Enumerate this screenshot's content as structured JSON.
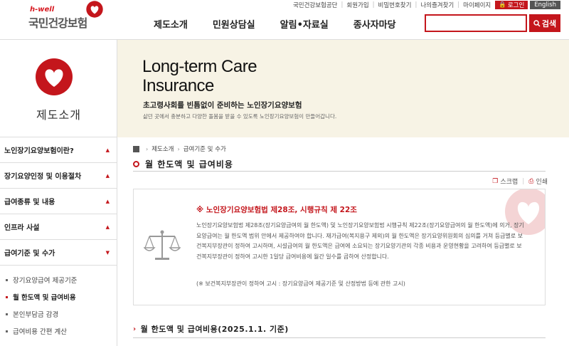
{
  "header": {
    "logo_small": "h-well",
    "logo_main": "국민건강보험",
    "util_links": [
      "국민건강보험공단",
      "회원가입",
      "비밀번호찾기",
      "나의즐겨찾기",
      "마이페이지"
    ],
    "login_label": "로그인",
    "english_label": "English",
    "gnb": [
      "제도소개",
      "민원상담실",
      "알림•자료실",
      "종사자마당"
    ],
    "search_placeholder": "",
    "search_label": "검색",
    "brand_color": "#c4161c"
  },
  "sidebar": {
    "title": "제도소개",
    "menu": [
      {
        "label": "노인장기요양보험이란?"
      },
      {
        "label": "장기요양인정 및 이용절차"
      },
      {
        "label": "급여종류 및 내용"
      },
      {
        "label": "인프라 사설"
      },
      {
        "label": "급여기준 및 수가"
      }
    ],
    "submenu": [
      {
        "label": "장기요양급여 제공기준",
        "active": false
      },
      {
        "label": "월 한도액 및 급여비용",
        "active": true
      },
      {
        "label": "본인부담금 감경",
        "active": false
      },
      {
        "label": "급여비용 간편 계산",
        "active": false
      }
    ]
  },
  "banner": {
    "title_line1": "Long-term Care",
    "title_line2": "Insurance",
    "subtitle": "초고령사회를 빈틈없이 준비하는 노인장기요양보험",
    "description": "삶던 곳에서 충분하고 다양한 돌봄을 받을 수 있도록 노인장기요양보험이 만들어갑니다."
  },
  "content": {
    "breadcrumb": [
      "제도소개",
      "급여기준 및 수가"
    ],
    "page_title": "월 한도액 및 급여비용",
    "scrap_label": "스크랩",
    "print_label": "인쇄",
    "law_heading": "※ 노인장기요양보험법 제28조, 시행규칙 제 22조",
    "law_body": "노인장기요양보험법 제28조(장기요양급여의 월 한도액) 및 노인장기요양보험법 시행규칙 제22조(장기요양급여의 월 한도액)에 의거, 장기요양급여는 월 한도액 범위 안에서 제공하여야 합니다. 재가급여(복지용구 제외)의 월 한도액은 장기요양위원회의 심의를 거쳐 등급별로 보건복지부장관이 정하여 고시하며, 시설급여의 월 한도액은 급여에 소요되는 장기요양기관의 각종 비용과 운영현황을 고려하여 등급별로 보건복지부장관이 정하여 고시한 1일당 급여비용에 월간 일수를 곱하여 산정합니다.",
    "law_note": "(※ 보건복지부장관이 정하여 고시 : 장기요양급여 제공기준 및 산정방법 등에 관한 고시)",
    "section_title": "월 한도액 및 급여비용(2025.1.1. 기준)"
  }
}
